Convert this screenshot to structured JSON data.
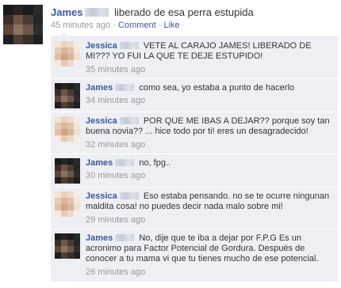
{
  "post": {
    "author": "James",
    "text": "liberado de esa perra estupida",
    "time": "45 minutes ago",
    "separator": "·",
    "comment_link": "Comment",
    "like_link": "Like"
  },
  "comments": [
    {
      "author": "Jessica",
      "text": "VETE AL CARAJO JAMES! LIBERADO DE MI??? YO FUI LA QUE TE DEJE ESTUPIDO!",
      "time": "35 minutes ago"
    },
    {
      "author": "James",
      "text": "como sea, yo estaba a punto de hacerlo",
      "time": "34 minutes ago"
    },
    {
      "author": "Jessica",
      "text": "POR QUE ME IBAS A DEJAR?? porque soy tan buena novia?? ... hice todo por ti! eres un desagradecido!",
      "time": "32 minutes ago"
    },
    {
      "author": "James",
      "text": "no, fpg..",
      "time": "30 minutes ago"
    },
    {
      "author": "Jessica",
      "text": "Eso estaba pensando. no se te ocurre ningunan maldita cosa! no puedes decir nada malo sobre mi!",
      "time": "29 minutes ago"
    },
    {
      "author": "James",
      "text": "No, dije que te iba a dejar por F.P.G Es un acronimo para Factor Potencial de Gordura. Después de conocer a tu mama vi que tu tienes mucho de ese potencial.",
      "time": "26 minutes ago"
    }
  ],
  "avatars": {
    "james_colors": [
      "#1a1a1a",
      "#2b2320",
      "#1c1c1c",
      "#2a2a2a",
      "#3a2f2a",
      "#6b5648",
      "#4a3a32",
      "#262626",
      "#5c4638",
      "#8d725f",
      "#6e5646",
      "#2d2d2d",
      "#1f1f1f",
      "#4e3f36",
      "#3a302a",
      "#202020"
    ],
    "jessica_colors": [
      "#f0e4d8",
      "#e8d2c0",
      "#eedccb",
      "#f4ece4",
      "#e6cdb8",
      "#d9b79c",
      "#e2c3aa",
      "#f1e5da",
      "#dfc1a6",
      "#cfa583",
      "#d8b597",
      "#ede0d2",
      "#f3e9df",
      "#e5cbb3",
      "#eadacb",
      "#f5eee8"
    ]
  }
}
